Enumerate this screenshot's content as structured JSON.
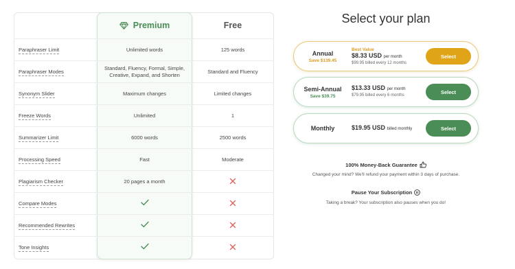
{
  "columns": {
    "premium": "Premium",
    "free": "Free"
  },
  "features": [
    {
      "name": "Paraphraser Limit",
      "premium": "Unlimited words",
      "free": "125 words"
    },
    {
      "name": "Paraphraser Modes",
      "premium": "Standard, Fluency, Formal, Simple, Creative, Expand, and Shorten",
      "free": "Standard and Fluency"
    },
    {
      "name": "Synonym Slider",
      "premium": "Maximum changes",
      "free": "Limited changes"
    },
    {
      "name": "Freeze Words",
      "premium": "Unlimited",
      "free": "1"
    },
    {
      "name": "Summarizer Limit",
      "premium": "6000 words",
      "free": "2500 words"
    },
    {
      "name": "Processing Speed",
      "premium": "Fast",
      "free": "Moderate"
    },
    {
      "name": "Plagiarism Checker",
      "premium": "20 pages a month",
      "free": ""
    },
    {
      "name": "Compare Modes",
      "premium": "",
      "free": ""
    },
    {
      "name": "Recommended Rewrites",
      "premium": "",
      "free": ""
    },
    {
      "name": "Tone Insights",
      "premium": "",
      "free": ""
    }
  ],
  "plans": {
    "title": "Select your plan",
    "annual": {
      "name": "Annual",
      "save": "Save $139.45",
      "badge": "Best Value",
      "price": "$8.33 USD",
      "per": "per month",
      "billed": "$99.95 billed every 12 months",
      "button": "Select"
    },
    "semi": {
      "name": "Semi-Annual",
      "save": "Save $39.75",
      "price": "$13.33 USD",
      "per": "per month",
      "billed": "$79.95 billed every 6 months",
      "button": "Select"
    },
    "monthly": {
      "name": "Monthly",
      "price": "$19.95 USD",
      "per": "billed monthly",
      "button": "Select"
    }
  },
  "guarantee": {
    "title": "100% Money-Back Guarantee",
    "text": "Changed your mind? We'll refund your payment within 3 days of purchase."
  },
  "pause": {
    "title": "Pause Your Subscription",
    "text": "Taking a break? Your subscription also pauses when you do!"
  },
  "colors": {
    "premium_green": "#4a8d56",
    "gold": "#e0a418",
    "cross_red": "#e05a5a"
  },
  "icons": {
    "premium": "diamond-icon",
    "included": "check-icon",
    "excluded": "cross-icon",
    "guarantee": "thumbs-up-icon",
    "pause": "pause-icon"
  }
}
